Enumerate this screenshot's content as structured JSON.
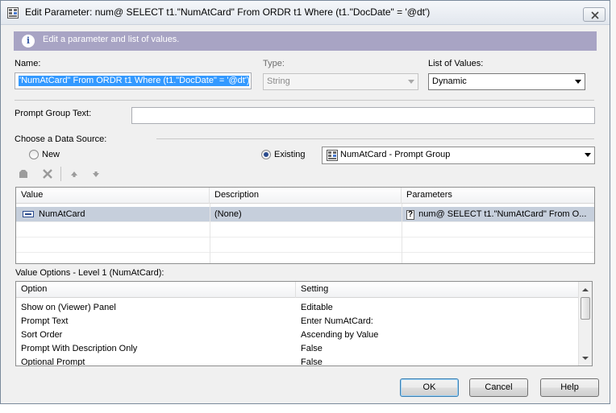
{
  "window": {
    "title": "Edit Parameter: num@ SELECT t1.\"NumAtCard\" From ORDR t1 Where (t1.\"DocDate\" = '@dt')"
  },
  "info": {
    "text": "Edit a parameter and list of values."
  },
  "fields": {
    "name_label": "Name:",
    "name_value": "'NumAtCard\" From ORDR t1 Where (t1.\"DocDate\" = '@dt')",
    "type_label": "Type:",
    "type_value": "String",
    "lov_label": "List of Values:",
    "lov_value": "Dynamic",
    "prompt_group_label": "Prompt Group Text:",
    "prompt_group_value": ""
  },
  "data_source": {
    "label": "Choose a Data Source:",
    "new_label": "New",
    "existing_label": "Existing",
    "selected": "existing",
    "existing_value": "NumAtCard - Prompt Group"
  },
  "values_table": {
    "columns": [
      "Value",
      "Description",
      "Parameters"
    ],
    "rows": [
      {
        "value": "NumAtCard",
        "description": "(None)",
        "parameters": "num@ SELECT t1.\"NumAtCard\" From O..."
      }
    ]
  },
  "options": {
    "title": "Value Options - Level 1 (NumAtCard):",
    "columns": [
      "Option",
      "Setting"
    ],
    "rows": [
      {
        "option": "Show on (Viewer) Panel",
        "setting": "Editable"
      },
      {
        "option": "Prompt Text",
        "setting": "Enter NumAtCard:"
      },
      {
        "option": "Sort Order",
        "setting": "Ascending by Value"
      },
      {
        "option": "Prompt With Description Only",
        "setting": "False"
      },
      {
        "option": "Optional Prompt",
        "setting": "False"
      }
    ]
  },
  "buttons": {
    "ok": "OK",
    "cancel": "Cancel",
    "help": "Help"
  },
  "colors": {
    "info_bar": "#a8a4c4",
    "selected_row": "#c6cfdc",
    "accent": "#2a4b8d"
  },
  "icons": {
    "title": "parameter-grid-icon",
    "info": "info-icon",
    "toolbar": [
      "bag-icon",
      "delete-icon",
      "move-up-icon",
      "move-down-icon"
    ]
  }
}
